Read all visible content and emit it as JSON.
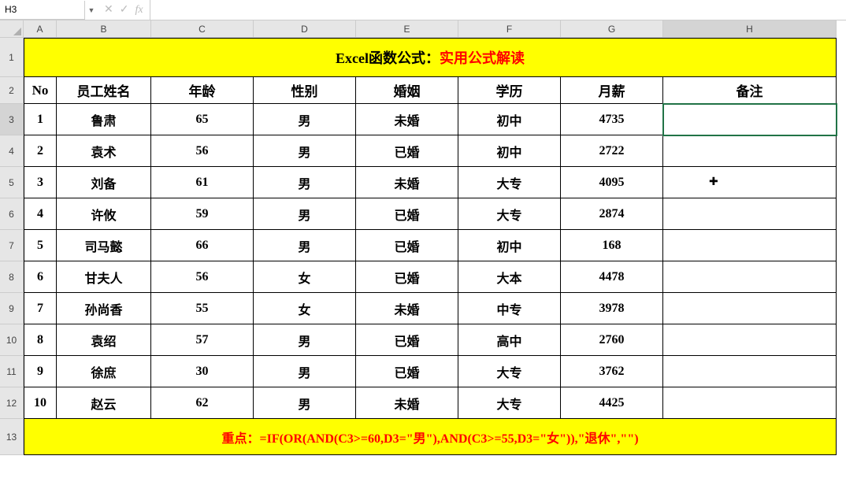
{
  "nameBox": "H3",
  "fxLabel": "fx",
  "colHeaders": [
    "A",
    "B",
    "C",
    "D",
    "E",
    "F",
    "G",
    "H"
  ],
  "rowHeaders": [
    "1",
    "2",
    "3",
    "4",
    "5",
    "6",
    "7",
    "8",
    "9",
    "10",
    "11",
    "12",
    "13"
  ],
  "title": {
    "black": "Excel函数公式：",
    "red": "实用公式解读"
  },
  "headers": [
    "No",
    "员工姓名",
    "年龄",
    "性别",
    "婚姻",
    "学历",
    "月薪",
    "备注"
  ],
  "rows": [
    {
      "no": "1",
      "name": "鲁肃",
      "age": "65",
      "sex": "男",
      "marriage": "未婚",
      "edu": "初中",
      "salary": "4735",
      "note": ""
    },
    {
      "no": "2",
      "name": "袁术",
      "age": "56",
      "sex": "男",
      "marriage": "已婚",
      "edu": "初中",
      "salary": "2722",
      "note": ""
    },
    {
      "no": "3",
      "name": "刘备",
      "age": "61",
      "sex": "男",
      "marriage": "未婚",
      "edu": "大专",
      "salary": "4095",
      "note": ""
    },
    {
      "no": "4",
      "name": "许攸",
      "age": "59",
      "sex": "男",
      "marriage": "已婚",
      "edu": "大专",
      "salary": "2874",
      "note": ""
    },
    {
      "no": "5",
      "name": "司马懿",
      "age": "66",
      "sex": "男",
      "marriage": "已婚",
      "edu": "初中",
      "salary": "168",
      "note": ""
    },
    {
      "no": "6",
      "name": "甘夫人",
      "age": "56",
      "sex": "女",
      "marriage": "已婚",
      "edu": "大本",
      "salary": "4478",
      "note": ""
    },
    {
      "no": "7",
      "name": "孙尚香",
      "age": "55",
      "sex": "女",
      "marriage": "未婚",
      "edu": "中专",
      "salary": "3978",
      "note": ""
    },
    {
      "no": "8",
      "name": "袁绍",
      "age": "57",
      "sex": "男",
      "marriage": "已婚",
      "edu": "高中",
      "salary": "2760",
      "note": ""
    },
    {
      "no": "9",
      "name": "徐庶",
      "age": "30",
      "sex": "男",
      "marriage": "已婚",
      "edu": "大专",
      "salary": "3762",
      "note": ""
    },
    {
      "no": "10",
      "name": "赵云",
      "age": "62",
      "sex": "男",
      "marriage": "未婚",
      "edu": "大专",
      "salary": "4425",
      "note": ""
    }
  ],
  "footer": "重点：=IF(OR(AND(C3>=60,D3=\"男\"),AND(C3>=55,D3=\"女\")),\"退休\",\"\")",
  "activeCell": "H3",
  "selectedCol": "H",
  "selectedRow": "3"
}
